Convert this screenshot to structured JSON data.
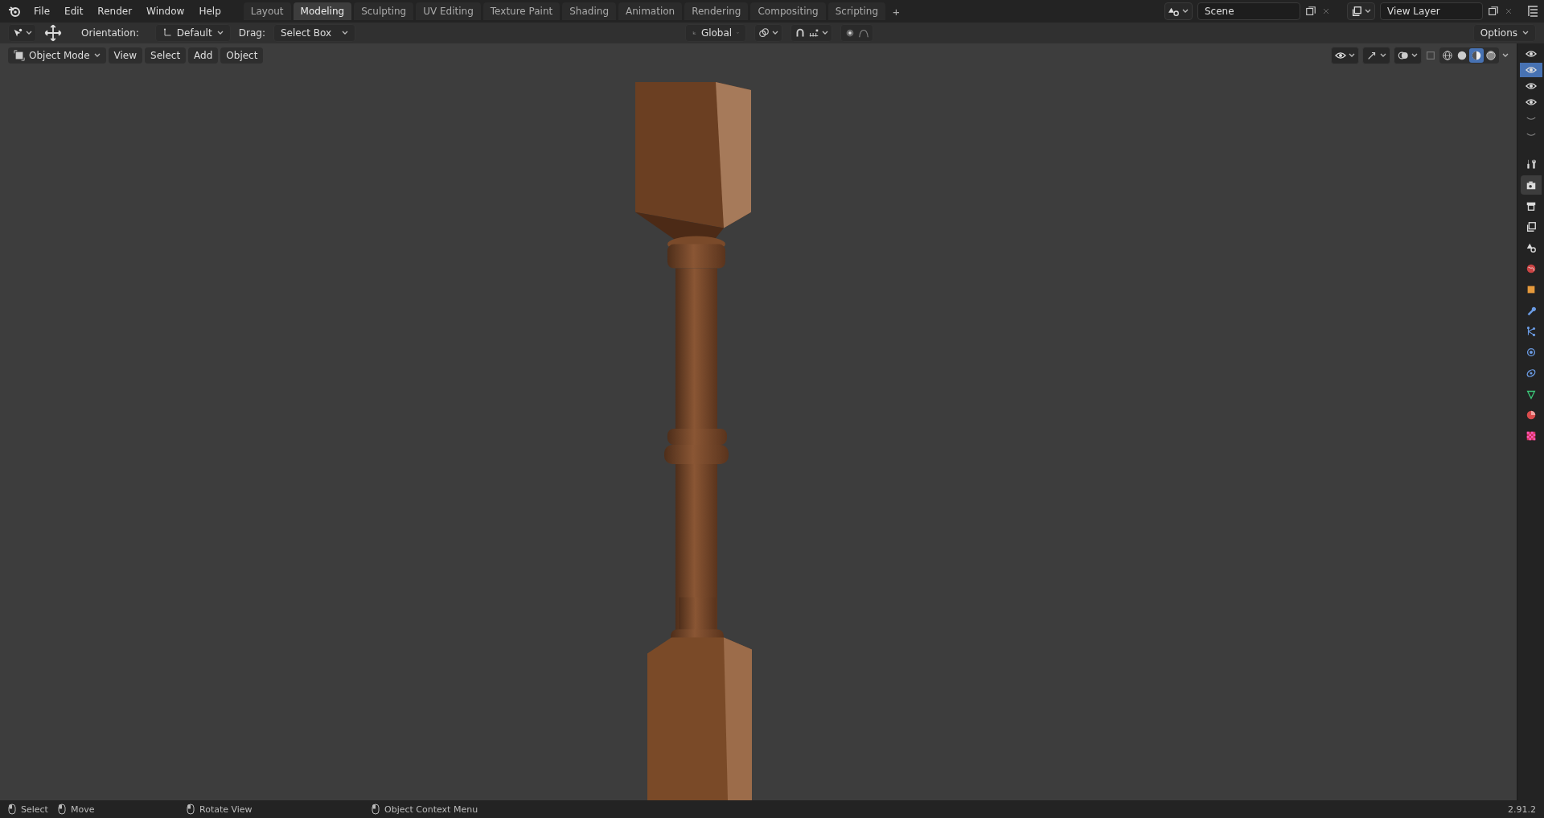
{
  "menu": [
    {
      "label": "File"
    },
    {
      "label": "Edit"
    },
    {
      "label": "Render"
    },
    {
      "label": "Window"
    },
    {
      "label": "Help"
    }
  ],
  "workspaces": [
    {
      "label": "Layout",
      "selected": false
    },
    {
      "label": "Modeling",
      "selected": true
    },
    {
      "label": "Sculpting",
      "selected": false
    },
    {
      "label": "UV Editing",
      "selected": false
    },
    {
      "label": "Texture Paint",
      "selected": false
    },
    {
      "label": "Shading",
      "selected": false
    },
    {
      "label": "Animation",
      "selected": false
    },
    {
      "label": "Rendering",
      "selected": false
    },
    {
      "label": "Compositing",
      "selected": false
    },
    {
      "label": "Scripting",
      "selected": false
    }
  ],
  "add_workspace": "+",
  "scene": {
    "value": "Scene"
  },
  "view_layer": {
    "value": "View Layer"
  },
  "tool_header": {
    "orientation_label": "Orientation:",
    "orientation": "Default",
    "drag_label": "Drag:",
    "drag": "Select Box",
    "transform_orientation": "Global",
    "options": "Options"
  },
  "viewport_header": {
    "mode": "Object Mode",
    "menus": [
      "View",
      "Select",
      "Add",
      "Object"
    ],
    "shading": [
      {
        "kind": "wireframe",
        "selected": false
      },
      {
        "kind": "solid",
        "selected": false
      },
      {
        "kind": "material",
        "selected": true
      },
      {
        "kind": "rendered",
        "selected": false
      }
    ]
  },
  "view_strip": [
    {
      "kind": "eye",
      "selected": false
    },
    {
      "kind": "eye",
      "selected": true
    },
    {
      "kind": "eye",
      "selected": false
    },
    {
      "kind": "eye",
      "selected": false
    },
    {
      "kind": "closed",
      "selected": false
    },
    {
      "kind": "closed",
      "selected": false
    }
  ],
  "properties_tabs": [
    {
      "kind": "tool",
      "selected": false
    },
    {
      "kind": "render",
      "selected": true
    },
    {
      "kind": "output",
      "selected": false
    },
    {
      "kind": "view_layer",
      "selected": false
    },
    {
      "kind": "scene",
      "selected": false
    },
    {
      "kind": "world",
      "selected": false
    },
    {
      "kind": "object",
      "selected": false
    },
    {
      "kind": "modifier",
      "selected": false
    },
    {
      "kind": "particles",
      "selected": false
    },
    {
      "kind": "physics",
      "selected": false
    },
    {
      "kind": "constraints",
      "selected": false
    },
    {
      "kind": "data",
      "selected": false
    },
    {
      "kind": "material",
      "selected": false
    },
    {
      "kind": "texture",
      "selected": false
    }
  ],
  "status_bar": {
    "hints": [
      {
        "label": "Select"
      },
      {
        "label": "Move"
      },
      {
        "label": "Rotate View"
      },
      {
        "label": "Object Context Menu"
      }
    ],
    "version": "2.91.2"
  }
}
